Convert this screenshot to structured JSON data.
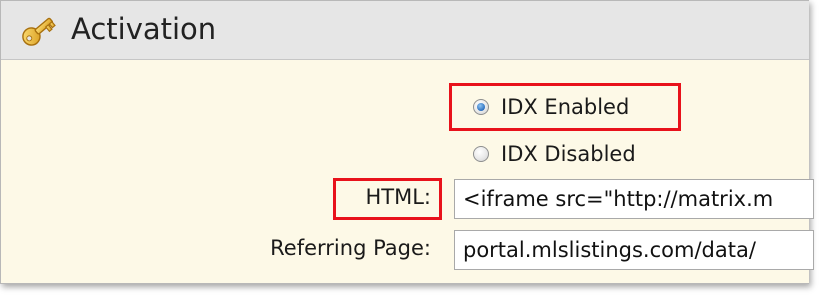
{
  "section": {
    "title": "Activation",
    "icon": "key-icon"
  },
  "idx": {
    "options": [
      {
        "label": "IDX Enabled",
        "selected": true
      },
      {
        "label": "IDX Disabled",
        "selected": false
      }
    ]
  },
  "fields": {
    "html": {
      "label": "HTML:",
      "value": "<iframe src=\"http://matrix.m"
    },
    "referring_page": {
      "label": "Referring Page:",
      "value": "portal.mlslistings.com/data/"
    }
  },
  "colors": {
    "highlight": "#e8121b",
    "header_bg": "#e6e6e6",
    "panel_bg": "#fdf9e7"
  }
}
